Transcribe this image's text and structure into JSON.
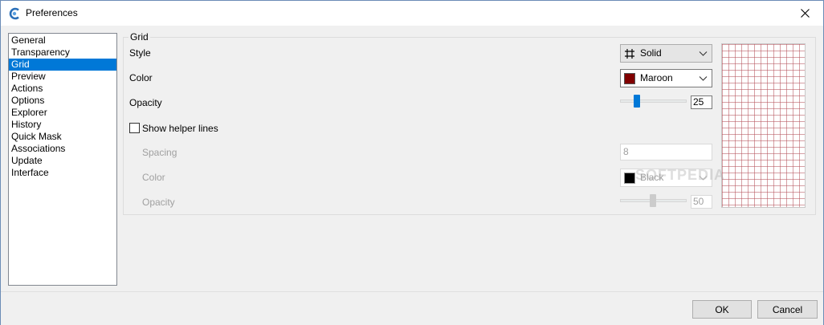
{
  "window": {
    "title": "Preferences"
  },
  "nav": {
    "items": [
      "General",
      "Transparency",
      "Grid",
      "Preview",
      "Actions",
      "Options",
      "Explorer",
      "History",
      "Quick Mask",
      "Associations",
      "Update",
      "Interface"
    ],
    "selected": "Grid"
  },
  "grid_group": {
    "title": "Grid",
    "style_label": "Style",
    "style_value": "Solid",
    "color_label": "Color",
    "color_value": "Maroon",
    "color_hex": "#800000",
    "opacity_label": "Opacity",
    "opacity_value": "25",
    "show_helper_label": "Show helper lines",
    "show_helper_checked": false,
    "spacing_label": "Spacing",
    "spacing_value": "8",
    "helper_color_label": "Color",
    "helper_color_value": "Black",
    "helper_color_hex": "#000000",
    "helper_opacity_label": "Opacity",
    "helper_opacity_value": "50"
  },
  "watermark": "SOFTPEDIA",
  "footer": {
    "ok_label": "OK",
    "cancel_label": "Cancel"
  },
  "colors": {
    "accent": "#0078d7",
    "grid_preview": "#b4505a"
  },
  "icons": {
    "app": "app-logo-icon",
    "close": "close-icon",
    "style": "grid-hash-icon",
    "dropdown": "chevron-down-icon"
  }
}
